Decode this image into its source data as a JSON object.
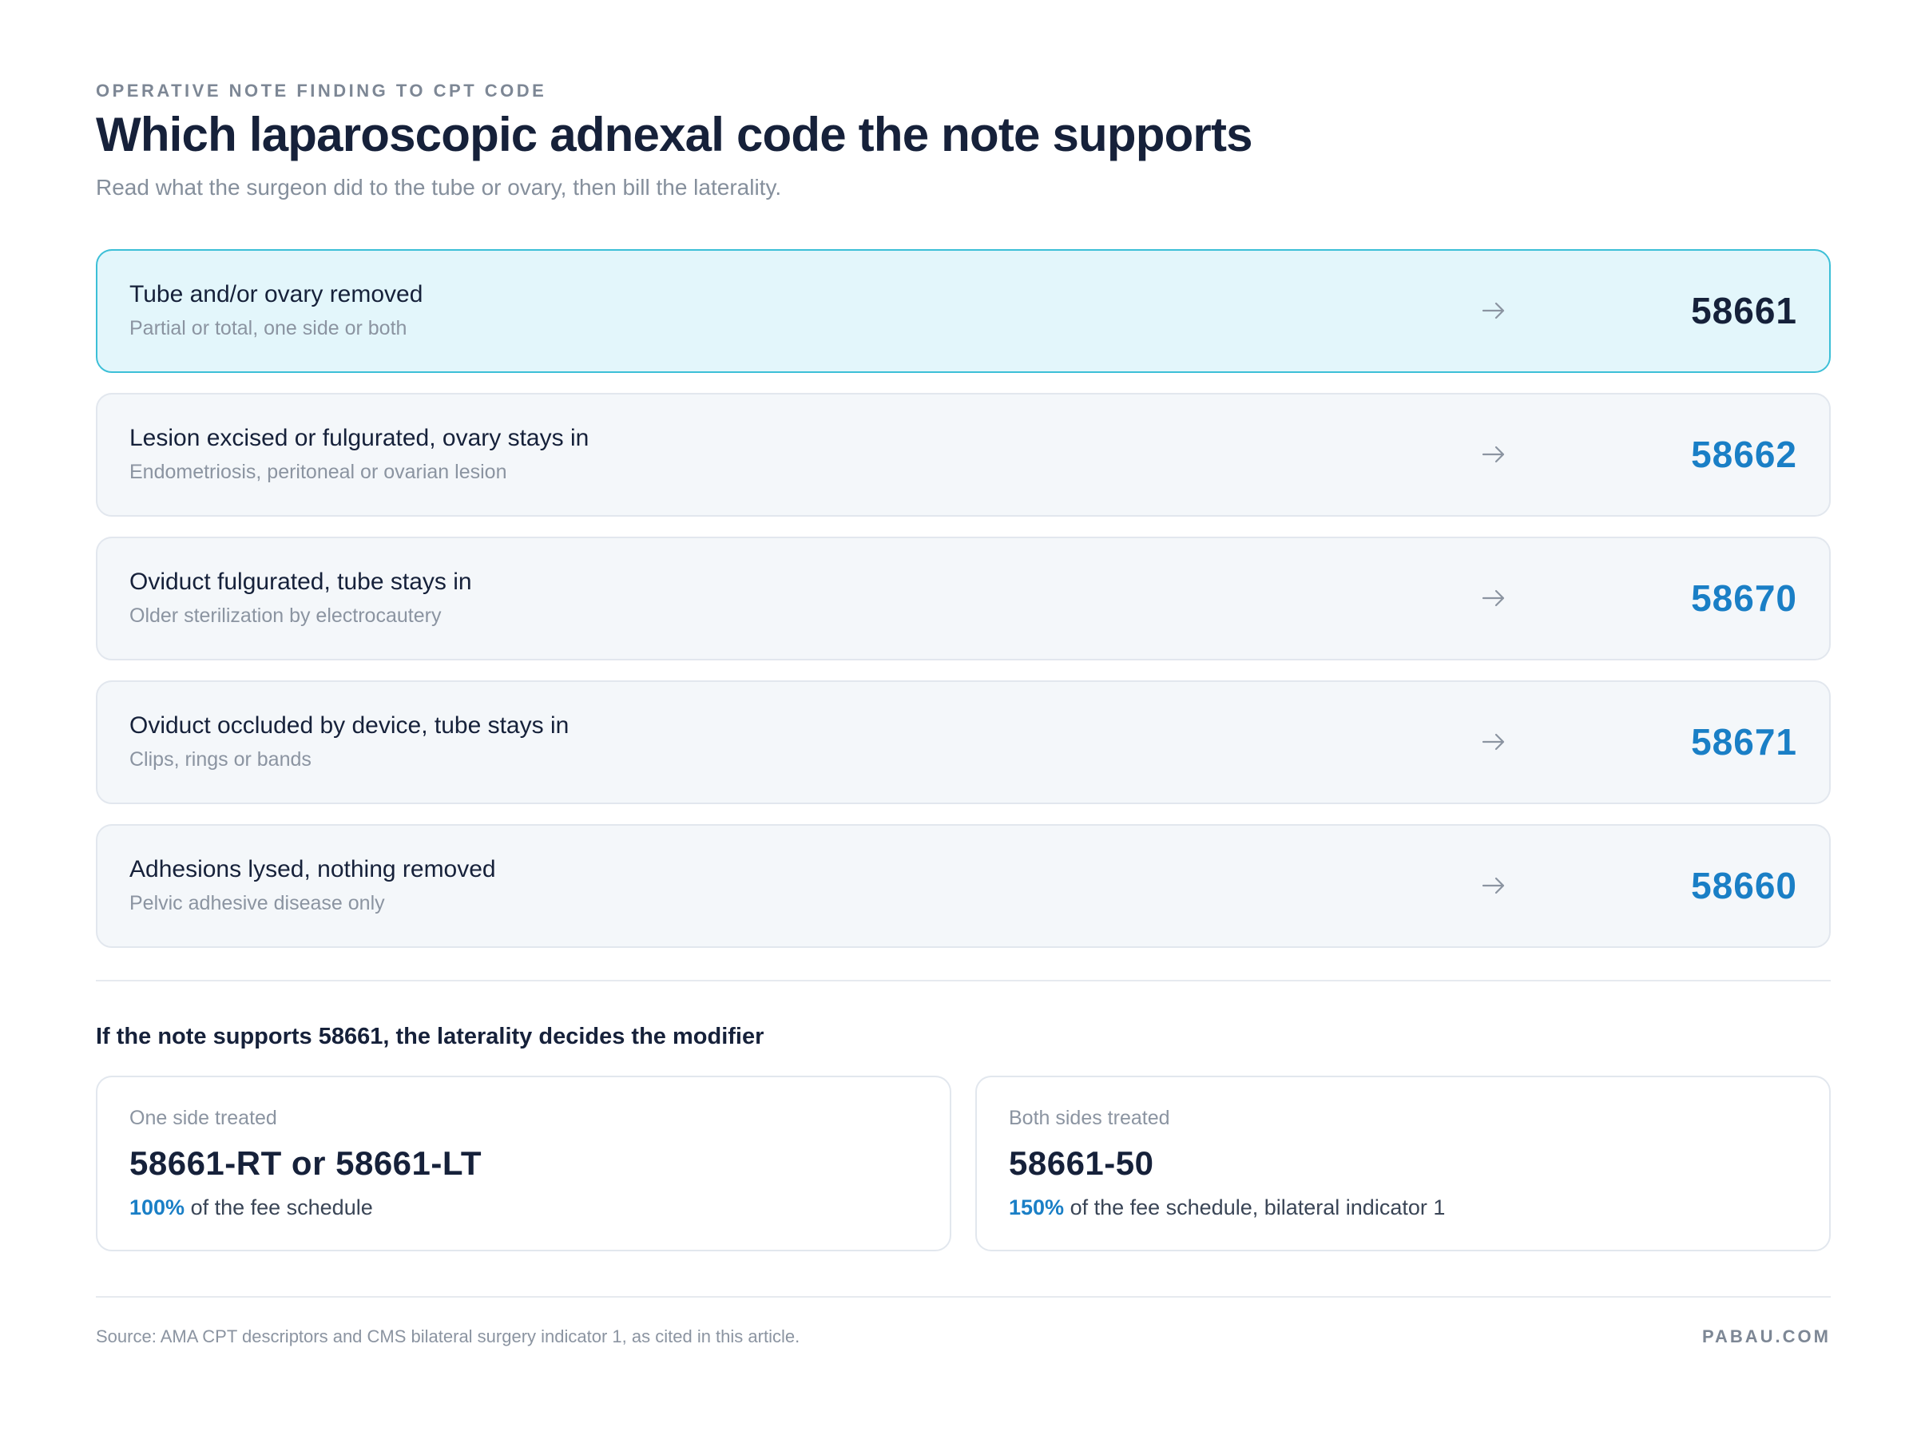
{
  "header": {
    "eyebrow": "OPERATIVE NOTE FINDING TO CPT CODE",
    "title": "Which laparoscopic adnexal code the note supports",
    "subtitle": "Read what the surgeon did to the tube or ovary, then bill the laterality."
  },
  "rows": [
    {
      "label": "Tube and/or ovary removed",
      "sub": "Partial or total, one side or both",
      "code": "58661",
      "highlighted": true
    },
    {
      "label": "Lesion excised or fulgurated, ovary stays in",
      "sub": "Endometriosis, peritoneal or ovarian lesion",
      "code": "58662",
      "highlighted": false
    },
    {
      "label": "Oviduct fulgurated, tube stays in",
      "sub": "Older sterilization by electrocautery",
      "code": "58670",
      "highlighted": false
    },
    {
      "label": "Oviduct occluded by device, tube stays in",
      "sub": "Clips, rings or bands",
      "code": "58671",
      "highlighted": false
    },
    {
      "label": "Adhesions lysed, nothing removed",
      "sub": "Pelvic adhesive disease only",
      "code": "58660",
      "highlighted": false
    }
  ],
  "modifier_section": {
    "heading": "If the note supports 58661, the laterality decides the modifier",
    "cards": [
      {
        "label": "One side treated",
        "code": "58661-RT or 58661-LT",
        "pct": "100%",
        "desc": " of the fee schedule"
      },
      {
        "label": "Both sides treated",
        "code": "58661-50",
        "pct": "150%",
        "desc": " of the fee schedule, bilateral indicator 1"
      }
    ]
  },
  "footer": {
    "source": "Source: AMA CPT descriptors and CMS bilateral surgery indicator 1, as cited in this article.",
    "brand": "PABAU.COM"
  },
  "icons": {
    "row_arrow": "arrow-right-icon"
  },
  "colors": {
    "accent": "#1a7fc6",
    "highlight_bg": "#e3f6fb",
    "highlight_border": "#3cbfd7",
    "row_bg": "#f4f7fa"
  }
}
